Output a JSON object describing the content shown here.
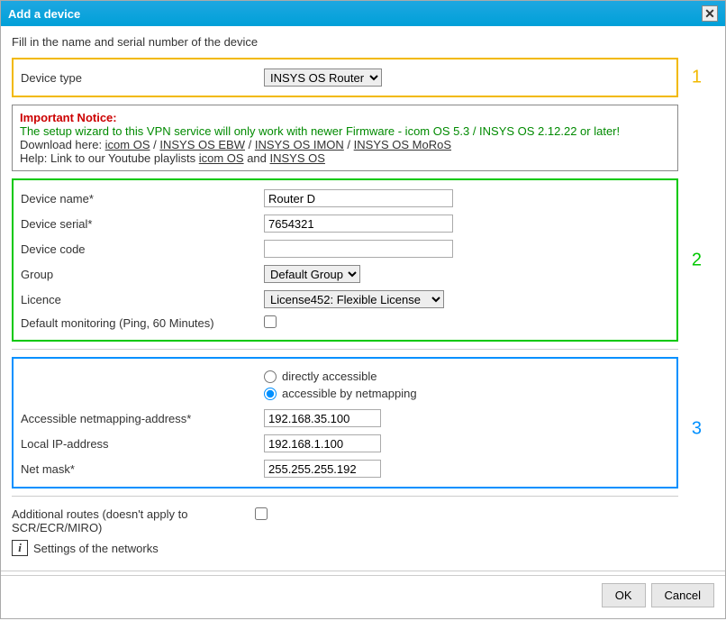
{
  "dialog": {
    "title": "Add a device",
    "close_label": "✕"
  },
  "intro": "Fill in the name and serial number of the device",
  "section1": {
    "label": "Device type",
    "select_value": "INSYS OS Router",
    "num": "1"
  },
  "notice": {
    "title": "Important Notice:",
    "line_green": "The setup wizard to this VPN service will only work with newer Firmware - icom OS 5.3 / INSYS OS 2.12.22 or later!",
    "download_prefix": "Download here: ",
    "link_icom": "icom OS",
    "link_ebw": "INSYS OS EBW",
    "link_imon": "INSYS OS IMON",
    "link_moros": "INSYS OS MoRoS",
    "help_prefix": "Help: Link to our Youtube playlists ",
    "help_link1": "icom OS",
    "help_and": " and ",
    "help_link2": "INSYS OS"
  },
  "section2": {
    "num": "2",
    "device_name_label": "Device name*",
    "device_name_value": "Router D",
    "device_serial_label": "Device serial*",
    "device_serial_value": "7654321",
    "device_code_label": "Device code",
    "device_code_value": "",
    "group_label": "Group",
    "group_value": "Default Group",
    "licence_label": "Licence",
    "licence_value": "License452: Flexible License",
    "monitoring_label": "Default monitoring (Ping, 60 Minutes)"
  },
  "section3": {
    "num": "3",
    "radio_direct": "directly accessible",
    "radio_netmap": "accessible by netmapping",
    "netmap_addr_label": "Accessible netmapping-address*",
    "netmap_addr_value": "192.168.35.100",
    "local_ip_label": "Local IP-address",
    "local_ip_value": "192.168.1.100",
    "netmask_label": "Net mask*",
    "netmask_value": "255.255.255.192"
  },
  "additional": {
    "label": "Additional routes (doesn't apply to SCR/ECR/MIRO)",
    "settings_label": "Settings of the networks",
    "info_icon": "i"
  },
  "footer": {
    "ok": "OK",
    "cancel": "Cancel"
  }
}
